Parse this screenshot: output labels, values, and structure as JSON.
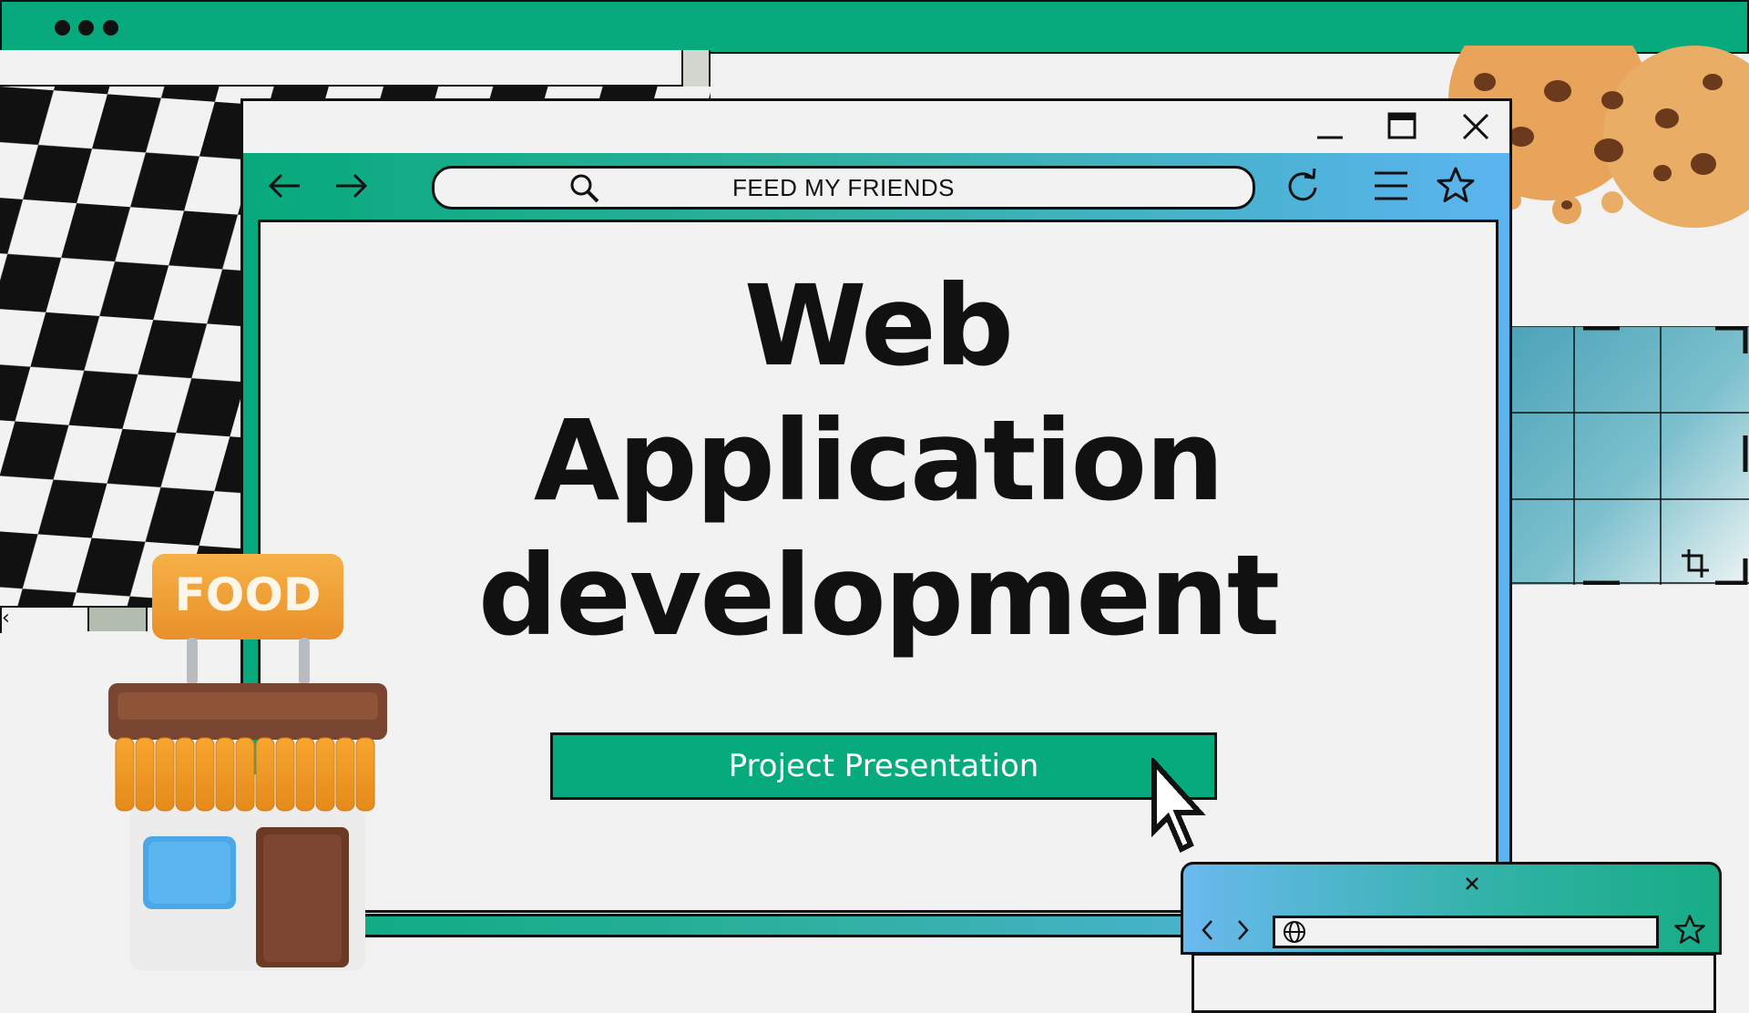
{
  "app": {
    "url_text": "FEED MY FRIENDS",
    "title_lines": [
      "Web",
      "Application",
      "development"
    ],
    "cta_label": "Project Presentation",
    "store_sign": "FOOD"
  },
  "colors": {
    "accent_green": "#07aa7c",
    "accent_blue": "#5cb4f0",
    "ink": "#111111",
    "background": "#f2f2f2"
  },
  "icons": {
    "window_controls": [
      "minimize-icon",
      "maximize-icon",
      "close-icon"
    ],
    "toolbar_left": [
      "back-arrow-icon",
      "forward-arrow-icon"
    ],
    "toolbar_right": [
      "refresh-icon",
      "menu-icon",
      "star-icon"
    ],
    "url": "search-icon",
    "popup": [
      "close-icon",
      "chevron-left-icon",
      "chevron-right-icon",
      "globe-icon",
      "star-icon"
    ]
  }
}
